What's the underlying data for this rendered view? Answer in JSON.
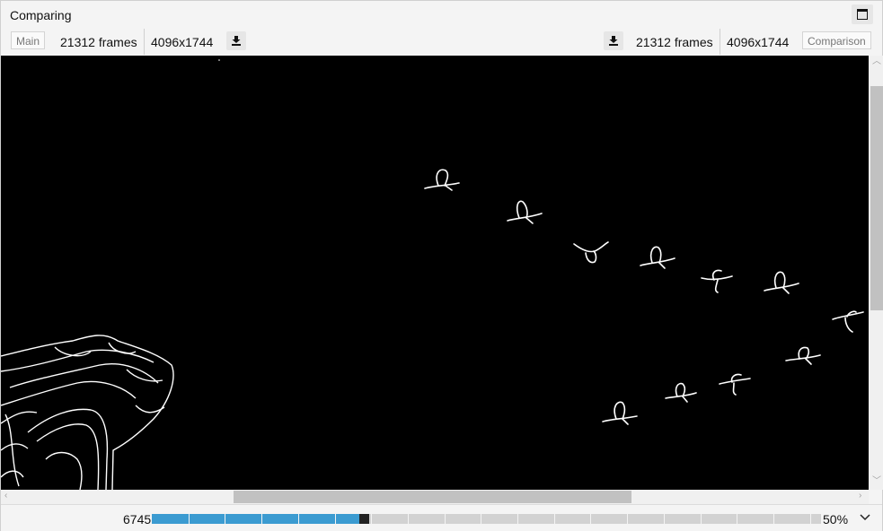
{
  "window": {
    "title": "Comparing"
  },
  "left": {
    "label": "Main",
    "frames": "21312 frames",
    "resolution": "4096x1744"
  },
  "right": {
    "label": "Comparison",
    "frames": "21312 frames",
    "resolution": "4096x1744"
  },
  "playback": {
    "frame": "6745",
    "progress": 0.31,
    "zoom": "50%"
  },
  "colors": {
    "played": "#3b9bd1",
    "background": "#000000",
    "edges": "#ffffff"
  },
  "icons": {
    "maximize": "maximize-icon",
    "download": "download-icon",
    "menu": "chevron-down-icon"
  }
}
